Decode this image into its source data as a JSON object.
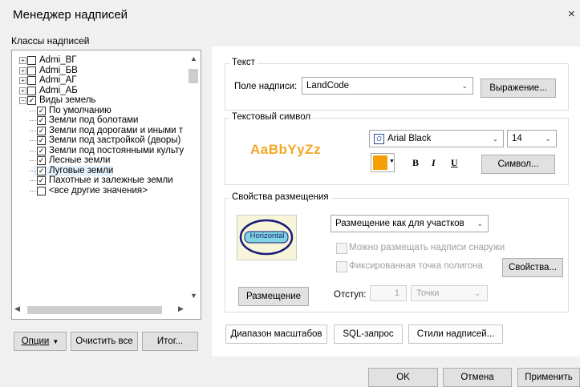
{
  "window": {
    "title": "Менеджер надписей",
    "close_glyph": "×"
  },
  "classes_label": "Классы надписей",
  "tree": {
    "items": [
      {
        "label": "Admi_ВГ",
        "checked": false,
        "level": 0,
        "expander": "+"
      },
      {
        "label": "Admi_БВ",
        "checked": false,
        "level": 0,
        "expander": "+"
      },
      {
        "label": "Admi_АГ",
        "checked": false,
        "level": 0,
        "expander": "+"
      },
      {
        "label": "Admi_АБ",
        "checked": false,
        "level": 0,
        "expander": "+"
      },
      {
        "label": "Виды земель",
        "checked": true,
        "level": 0,
        "expander": "−"
      },
      {
        "label": "По умолчанию",
        "checked": true,
        "level": 1
      },
      {
        "label": "Земли под болотами",
        "checked": true,
        "level": 1
      },
      {
        "label": "Земли под дорогами и иными т",
        "checked": true,
        "level": 1
      },
      {
        "label": "Земли под застройкой (дворы)",
        "checked": true,
        "level": 1
      },
      {
        "label": "Земли под постоянными культу",
        "checked": true,
        "level": 1
      },
      {
        "label": "Лесные земли",
        "checked": true,
        "level": 1
      },
      {
        "label": "Луговые земли",
        "checked": true,
        "level": 1,
        "selected": true
      },
      {
        "label": "Пахотные и залежные земли",
        "checked": true,
        "level": 1
      },
      {
        "label": "<все другие значения>",
        "checked": false,
        "level": 1
      }
    ],
    "check_glyph": "✓"
  },
  "left_buttons": {
    "options": "Опции",
    "clear_all": "Очистить все",
    "summary": "Итог..."
  },
  "text_group": {
    "legend": "Текст",
    "field_label": "Поле надписи:",
    "field_value": "LandCode",
    "expression_button": "Выражение..."
  },
  "symbol_group": {
    "legend": "Текстовый символ",
    "preview": "AaBbYyZz",
    "font_value": "Arial Black",
    "font_icon": "O",
    "size_value": "14",
    "bold": "B",
    "italic": "I",
    "underline": "U",
    "symbol_button": "Символ...",
    "preview_color": "#f5a623",
    "fill_color": "#f5a000"
  },
  "placement_group": {
    "legend": "Свойства размещения",
    "preview_text": "Horizontal",
    "mode_value": "Размещение как для участков",
    "outside_label": "Можно размещать надписи снаружи",
    "fixed_label": "Фиксированная точка полигона",
    "properties_button": "Свойства...",
    "placement_button": "Размещение",
    "offset_label": "Отступ:",
    "offset_value": "1",
    "units_value": "Точки"
  },
  "bottom_buttons": {
    "scale_range": "Диапазон масштабов",
    "sql": "SQL-запрос",
    "styles": "Стили надписей..."
  },
  "dialog_buttons": {
    "ok": "OK",
    "cancel": "Отмена",
    "apply": "Применить"
  }
}
